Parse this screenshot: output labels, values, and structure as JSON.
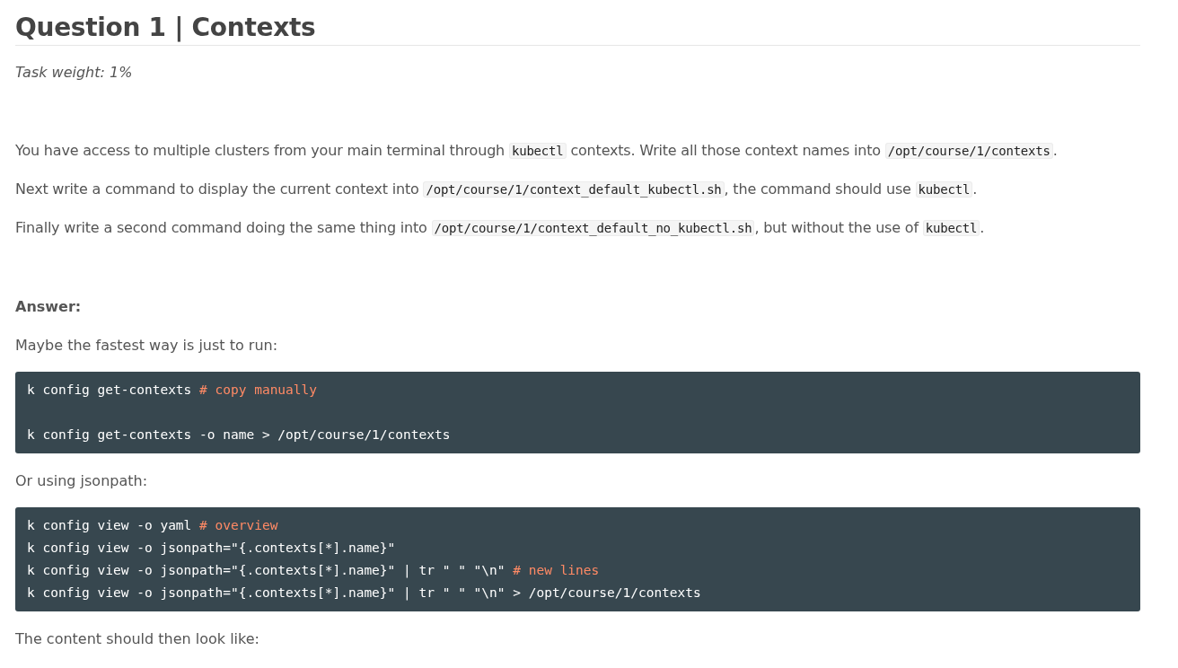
{
  "title": "Question 1 | Contexts",
  "task_weight": "Task weight: 1%",
  "task_paragraphs": [
    [
      {
        "kind": "text",
        "text": "You have access to multiple clusters from your main terminal through "
      },
      {
        "kind": "code",
        "text": "kubectl"
      },
      {
        "kind": "text",
        "text": " contexts. Write all those context names into "
      },
      {
        "kind": "code",
        "text": "/opt/course/1/contexts"
      },
      {
        "kind": "text",
        "text": "."
      }
    ],
    [
      {
        "kind": "text",
        "text": "Next write a command to display the current context into "
      },
      {
        "kind": "code",
        "text": "/opt/course/1/context_default_kubectl.sh"
      },
      {
        "kind": "text",
        "text": ", the command should use "
      },
      {
        "kind": "code",
        "text": "kubectl"
      },
      {
        "kind": "text",
        "text": "."
      }
    ],
    [
      {
        "kind": "text",
        "text": "Finally write a second command doing the same thing into "
      },
      {
        "kind": "code",
        "text": "/opt/course/1/context_default_no_kubectl.sh"
      },
      {
        "kind": "text",
        "text": ", but without the use of "
      },
      {
        "kind": "code",
        "text": "kubectl"
      },
      {
        "kind": "text",
        "text": "."
      }
    ]
  ],
  "answer_label": "Answer:",
  "answer": [
    {
      "kind": "paragraph",
      "text": "Maybe the fastest way is just to run:"
    },
    {
      "kind": "code_block",
      "lines": [
        {
          "kind": "line",
          "code": "k config get-contexts ",
          "comment": "# copy manually"
        },
        {
          "kind": "blank"
        },
        {
          "kind": "line",
          "code": "k config get-contexts -o name > /opt/course/1/contexts"
        }
      ]
    },
    {
      "kind": "paragraph",
      "text": "Or using jsonpath:"
    },
    {
      "kind": "code_block",
      "lines": [
        {
          "kind": "line",
          "code": "k config view -o yaml ",
          "comment": "# overview"
        },
        {
          "kind": "line",
          "code": "k config view -o jsonpath=\"{.contexts[*].name}\""
        },
        {
          "kind": "line",
          "code": "k config view -o jsonpath=\"{.contexts[*].name}\" | tr \" \" \"\\n\" ",
          "comment": "# new lines"
        },
        {
          "kind": "line",
          "code": "k config view -o jsonpath=\"{.contexts[*].name}\" | tr \" \" \"\\n\" > /opt/course/1/contexts"
        }
      ]
    },
    {
      "kind": "paragraph",
      "text": "The content should then look like:"
    }
  ]
}
